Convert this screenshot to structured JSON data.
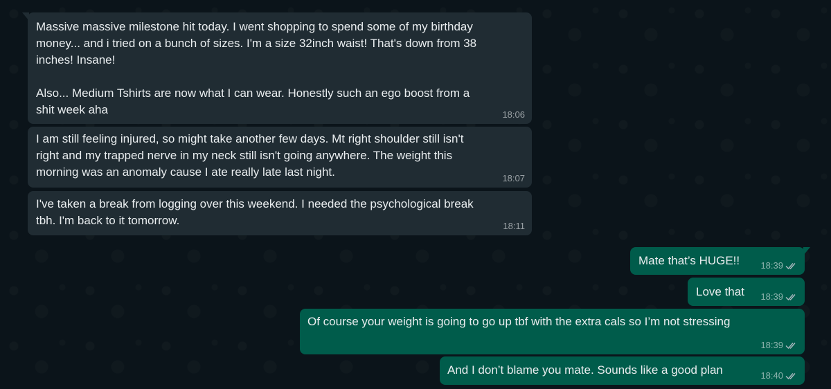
{
  "messages": [
    {
      "text": "Massive massive milestone hit today. I went shopping to spend some of my birthday\nmoney... and i tried on a bunch of sizes. I'm a size 32inch waist! That's down from 38\ninches! Insane!\n\nAlso... Medium Tshirts are now what I can wear. Honestly such an ego boost from a\nshit week aha",
      "time": "18:06",
      "direction": "incoming"
    },
    {
      "text": "I am still feeling injured, so might take another few days. Mt right shoulder still isn't\nright and my trapped nerve in my neck still isn't going anywhere. The weight this\nmorning was an anomaly cause I ate really late last night.",
      "time": "18:07",
      "direction": "incoming"
    },
    {
      "text": "I've taken a break from logging over this weekend. I needed the psychological break\ntbh. I'm back to it tomorrow.",
      "time": "18:11",
      "direction": "incoming"
    },
    {
      "text": "Mate that’s HUGE!!",
      "time": "18:39",
      "direction": "outgoing",
      "status_icon": "double-check-icon"
    },
    {
      "text": "Love that",
      "time": "18:39",
      "direction": "outgoing",
      "status_icon": "double-check-icon"
    },
    {
      "text": "Of course your weight is going to go up tbf with the extra cals so I’m not stressing",
      "time": "18:39",
      "direction": "outgoing",
      "status_icon": "double-check-icon"
    },
    {
      "text": "And I don’t blame you mate. Sounds like a good plan",
      "time": "18:40",
      "direction": "outgoing",
      "status_icon": "double-check-icon"
    }
  ],
  "colors": {
    "background": "#0b141a",
    "incoming_bubble": "#202c33",
    "outgoing_bubble": "#005c4b",
    "text": "#e9edef",
    "meta_text": "#8696a0"
  }
}
